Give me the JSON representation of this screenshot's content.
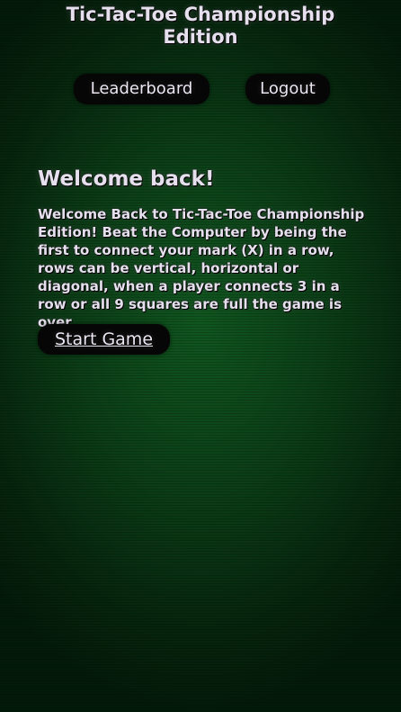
{
  "header": {
    "title_line1": "Tic-Tac-Toe Championship",
    "title_line2": "Edition"
  },
  "nav": {
    "leaderboard_label": "Leaderboard",
    "logout_label": "Logout"
  },
  "main": {
    "heading": "Welcome back!",
    "description": "Welcome Back to Tic-Tac-Toe Championship Edition! Beat the Computer by being the first to connect your mark (X) in a row, rows can be vertical, horizontal or diagonal, when a player connects 3 in a row or all 9 squares are full the game is over.",
    "start_label": "Start Game"
  },
  "colors": {
    "background": "#0b3d16",
    "button": "#060606",
    "text": "#e6e0ee"
  }
}
